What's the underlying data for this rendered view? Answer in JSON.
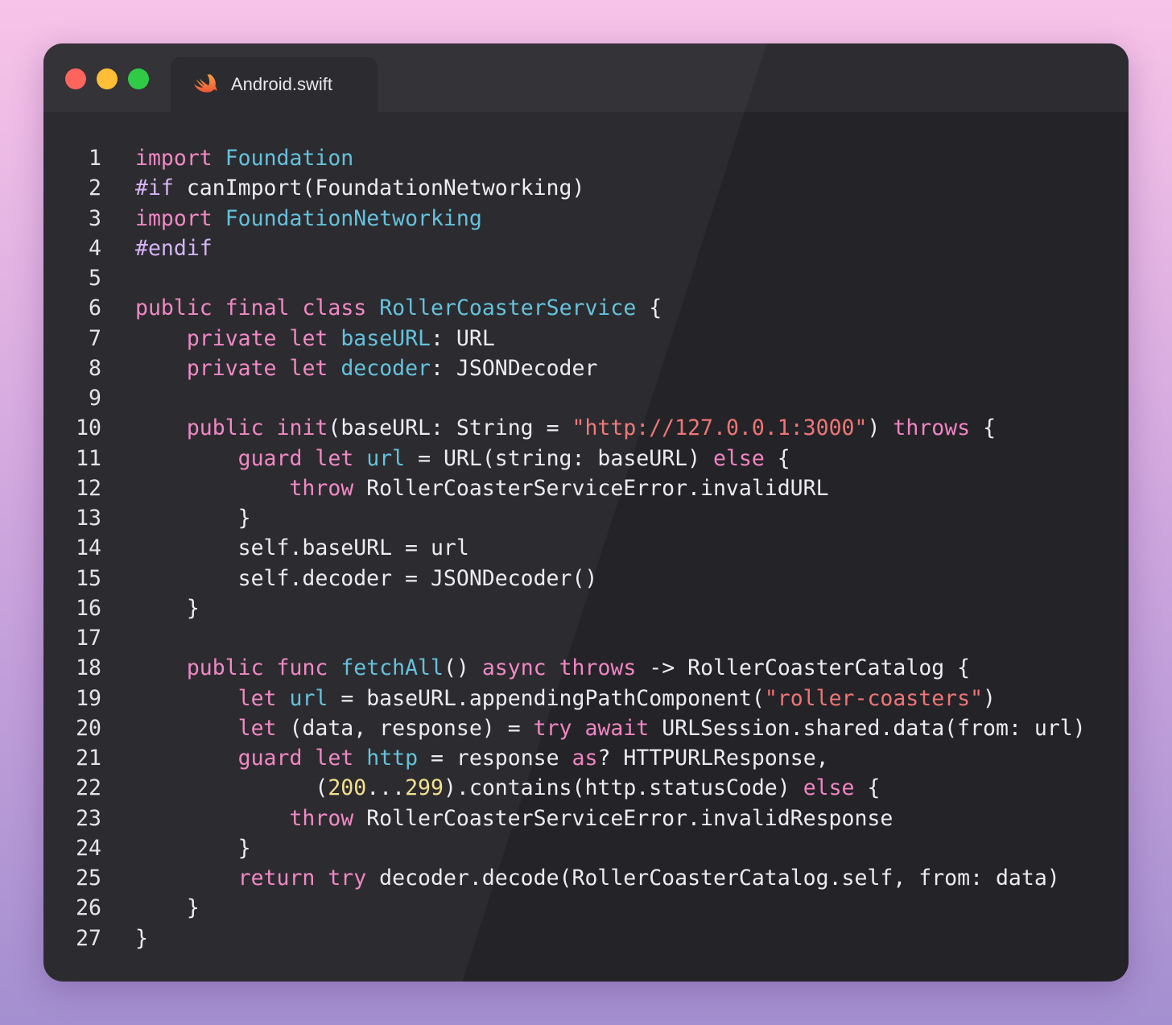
{
  "window": {
    "tab": {
      "title": "Android.swift",
      "icon": "swift-icon"
    },
    "controls": [
      "close",
      "minimize",
      "maximize"
    ]
  },
  "colors": {
    "keyword": "#f284c3",
    "type": "#5fc0dc",
    "preprocessor": "#d3b1f5",
    "string": "#f07575",
    "number": "#f3e08a",
    "plain": "#ececf0",
    "close": "#fe5f57",
    "minimize": "#febc2e",
    "maximize": "#28c840"
  },
  "code": {
    "language": "swift",
    "lines": [
      [
        [
          "k",
          "import"
        ],
        [
          "p",
          " "
        ],
        [
          "t",
          "Foundation"
        ]
      ],
      [
        [
          "pp",
          "#if"
        ],
        [
          "p",
          " canImport(FoundationNetworking)"
        ]
      ],
      [
        [
          "k",
          "import"
        ],
        [
          "p",
          " "
        ],
        [
          "t",
          "FoundationNetworking"
        ]
      ],
      [
        [
          "pp",
          "#endif"
        ]
      ],
      [],
      [
        [
          "k",
          "public"
        ],
        [
          "p",
          " "
        ],
        [
          "k",
          "final"
        ],
        [
          "p",
          " "
        ],
        [
          "k",
          "class"
        ],
        [
          "p",
          " "
        ],
        [
          "t",
          "RollerCoasterService"
        ],
        [
          "p",
          " {"
        ]
      ],
      [
        [
          "p",
          "    "
        ],
        [
          "k",
          "private"
        ],
        [
          "p",
          " "
        ],
        [
          "k",
          "let"
        ],
        [
          "p",
          " "
        ],
        [
          "t",
          "baseURL"
        ],
        [
          "p",
          ": URL"
        ]
      ],
      [
        [
          "p",
          "    "
        ],
        [
          "k",
          "private"
        ],
        [
          "p",
          " "
        ],
        [
          "k",
          "let"
        ],
        [
          "p",
          " "
        ],
        [
          "t",
          "decoder"
        ],
        [
          "p",
          ": JSONDecoder"
        ]
      ],
      [],
      [
        [
          "p",
          "    "
        ],
        [
          "k",
          "public"
        ],
        [
          "p",
          " "
        ],
        [
          "k",
          "init"
        ],
        [
          "p",
          "(baseURL: String = "
        ],
        [
          "s",
          "\"http://127.0.0.1:3000\""
        ],
        [
          "p",
          ") "
        ],
        [
          "k",
          "throws"
        ],
        [
          "p",
          " {"
        ]
      ],
      [
        [
          "p",
          "        "
        ],
        [
          "k",
          "guard"
        ],
        [
          "p",
          " "
        ],
        [
          "k",
          "let"
        ],
        [
          "p",
          " "
        ],
        [
          "t",
          "url"
        ],
        [
          "p",
          " = URL(string: baseURL) "
        ],
        [
          "k",
          "else"
        ],
        [
          "p",
          " {"
        ]
      ],
      [
        [
          "p",
          "            "
        ],
        [
          "k",
          "throw"
        ],
        [
          "p",
          " RollerCoasterServiceError.invalidURL"
        ]
      ],
      [
        [
          "p",
          "        }"
        ]
      ],
      [
        [
          "p",
          "        self.baseURL = url"
        ]
      ],
      [
        [
          "p",
          "        self.decoder = JSONDecoder()"
        ]
      ],
      [
        [
          "p",
          "    }"
        ]
      ],
      [],
      [
        [
          "p",
          "    "
        ],
        [
          "k",
          "public"
        ],
        [
          "p",
          " "
        ],
        [
          "k",
          "func"
        ],
        [
          "p",
          " "
        ],
        [
          "t",
          "fetchAll"
        ],
        [
          "p",
          "() "
        ],
        [
          "k",
          "async"
        ],
        [
          "p",
          " "
        ],
        [
          "k",
          "throws"
        ],
        [
          "p",
          " -> RollerCoasterCatalog {"
        ]
      ],
      [
        [
          "p",
          "        "
        ],
        [
          "k",
          "let"
        ],
        [
          "p",
          " "
        ],
        [
          "t",
          "url"
        ],
        [
          "p",
          " = baseURL.appendingPathComponent("
        ],
        [
          "s",
          "\"roller-coasters\""
        ],
        [
          "p",
          ")"
        ]
      ],
      [
        [
          "p",
          "        "
        ],
        [
          "k",
          "let"
        ],
        [
          "p",
          " (data, response) = "
        ],
        [
          "k",
          "try"
        ],
        [
          "p",
          " "
        ],
        [
          "k",
          "await"
        ],
        [
          "p",
          " URLSession.shared.data(from: url)"
        ]
      ],
      [
        [
          "p",
          "        "
        ],
        [
          "k",
          "guard"
        ],
        [
          "p",
          " "
        ],
        [
          "k",
          "let"
        ],
        [
          "p",
          " "
        ],
        [
          "t",
          "http"
        ],
        [
          "p",
          " = response "
        ],
        [
          "k",
          "as"
        ],
        [
          "p",
          "? HTTPURLResponse,"
        ]
      ],
      [
        [
          "p",
          "              ("
        ],
        [
          "n",
          "200"
        ],
        [
          "p",
          "..."
        ],
        [
          "n",
          "299"
        ],
        [
          "p",
          ").contains(http.statusCode) "
        ],
        [
          "k",
          "else"
        ],
        [
          "p",
          " {"
        ]
      ],
      [
        [
          "p",
          "            "
        ],
        [
          "k",
          "throw"
        ],
        [
          "p",
          " RollerCoasterServiceError.invalidResponse"
        ]
      ],
      [
        [
          "p",
          "        }"
        ]
      ],
      [
        [
          "p",
          "        "
        ],
        [
          "k",
          "return"
        ],
        [
          "p",
          " "
        ],
        [
          "k",
          "try"
        ],
        [
          "p",
          " decoder.decode(RollerCoasterCatalog.self, from: data)"
        ]
      ],
      [
        [
          "p",
          "    }"
        ]
      ],
      [
        [
          "p",
          "}"
        ]
      ]
    ]
  }
}
